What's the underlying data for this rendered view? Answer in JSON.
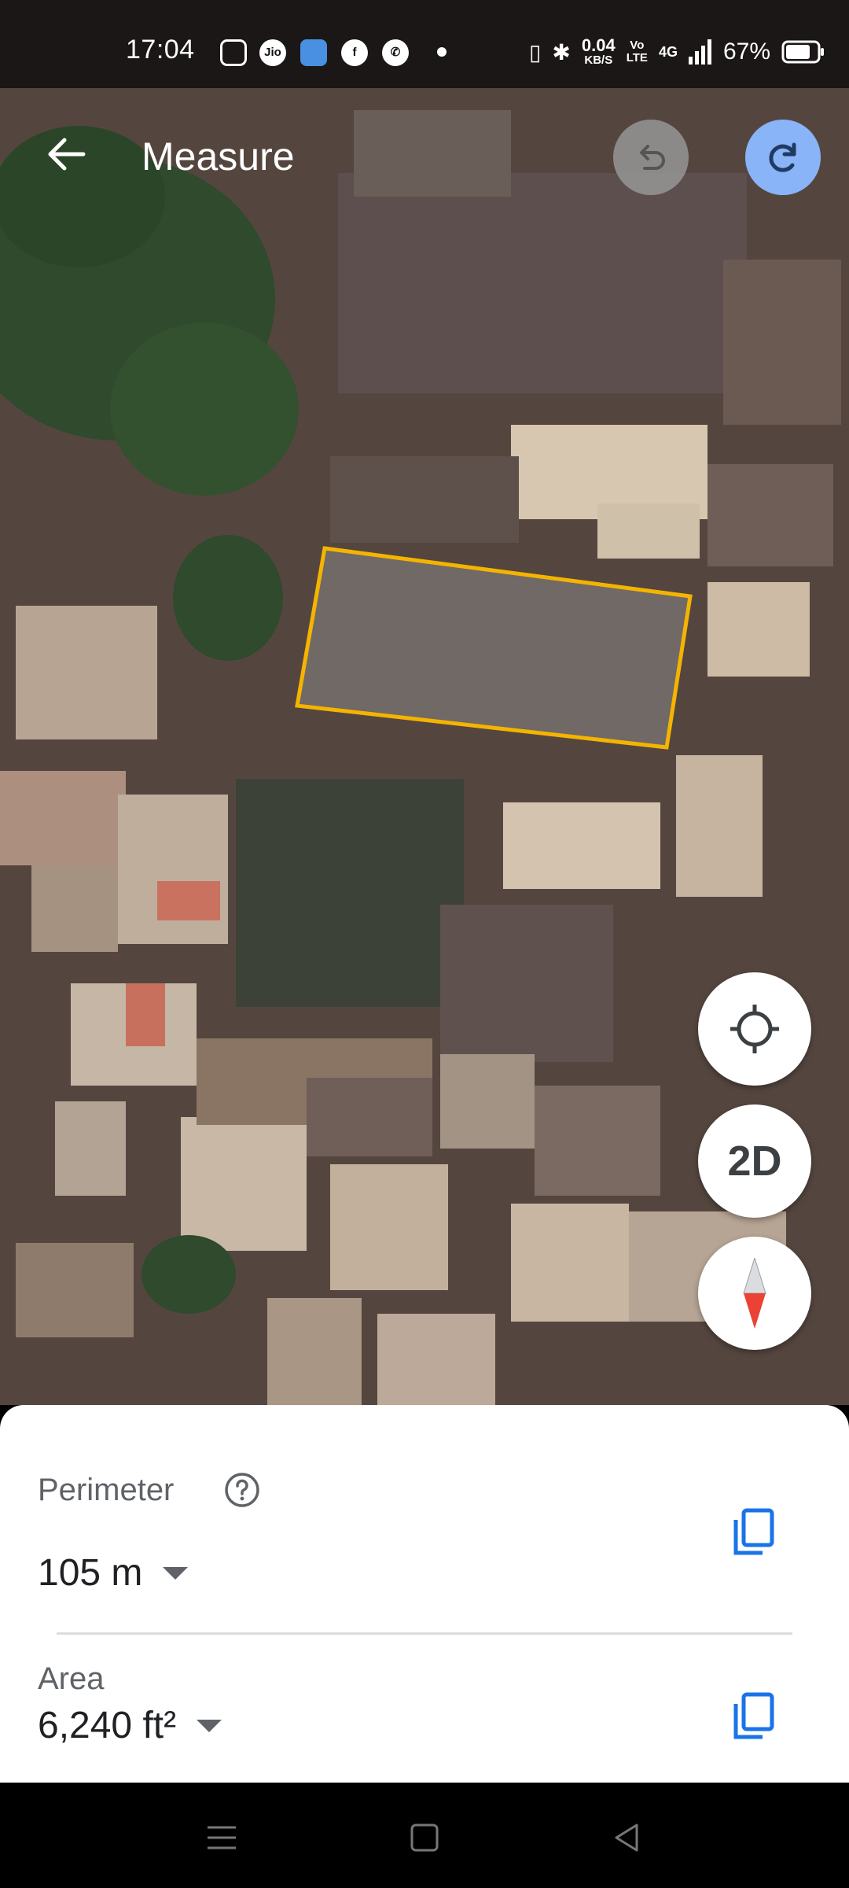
{
  "status_bar": {
    "time": "17:04",
    "apps": [
      "instagram-icon",
      "jio-icon",
      "app-icon",
      "facebook-icon",
      "phone-icon",
      "dot-icon"
    ],
    "jio_label": "Jio",
    "speed_value": "0.04",
    "speed_unit": "KB/S",
    "volte_top": "Vo",
    "volte_bottom": "LTE",
    "network": "4G",
    "battery": "67%"
  },
  "top_bar": {
    "title": "Measure"
  },
  "controls": {
    "mode_label": "2D"
  },
  "measurement": {
    "perimeter_label": "Perimeter",
    "perimeter_value": "105 m",
    "area_label": "Area",
    "area_value": "6,240 ft²",
    "shape_color": "#f4b400"
  },
  "colors": {
    "accent": "#1a73e8",
    "redo_bg": "#8ab4f8"
  }
}
